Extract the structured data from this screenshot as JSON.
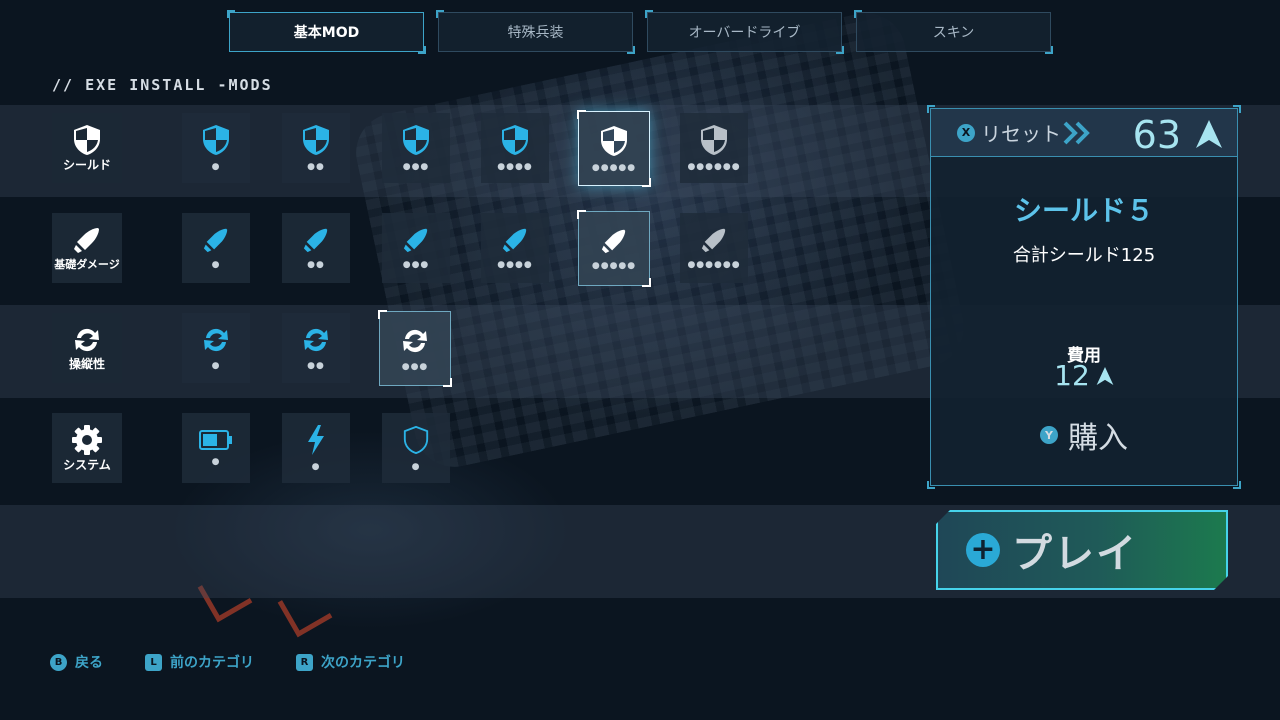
{
  "tabs": [
    {
      "label": "基本MOD",
      "active": true
    },
    {
      "label": "特殊兵装",
      "active": false
    },
    {
      "label": "オーバードライブ",
      "active": false
    },
    {
      "label": "スキン",
      "active": false
    }
  ],
  "section_title": "// EXE INSTALL -MODS",
  "categories": [
    {
      "label": "シールド",
      "icon": "shield-icon"
    },
    {
      "label": "基礎ダメージ",
      "icon": "bullet-icon"
    },
    {
      "label": "操縦性",
      "icon": "rotate-arrows-icon"
    },
    {
      "label": "システム",
      "icon": "gear-icon"
    }
  ],
  "mod_rows": {
    "shield": {
      "levels": [
        "●",
        "●●",
        "●●●",
        "●●●●",
        "●●●●●",
        "●●●●●●"
      ]
    },
    "damage": {
      "levels": [
        "●",
        "●●",
        "●●●",
        "●●●●",
        "●●●●●",
        "●●●●●●"
      ]
    },
    "handling": {
      "levels": [
        "●",
        "●●",
        "●●●"
      ]
    },
    "system": {
      "levels": [
        "●",
        "●",
        "●"
      ],
      "icons": [
        "battery-icon",
        "lightning-icon",
        "shield-outline-icon"
      ]
    }
  },
  "panel": {
    "reset_key": "X",
    "reset_label": "リセット",
    "credits": "63",
    "mod_name": "シールド５",
    "mod_desc": "合計シールド125",
    "cost_label": "費用",
    "cost_value": "12",
    "buy_key": "Y",
    "buy_label": "購入"
  },
  "play": {
    "label": "プレイ"
  },
  "hints": [
    {
      "key": "B",
      "label": "戻る"
    },
    {
      "key": "L",
      "label": "前のカテゴリ"
    },
    {
      "key": "R",
      "label": "次のカテゴリ"
    }
  ],
  "colors": {
    "accent": "#3da4c8",
    "active_icon": "#2bb3e6",
    "credit": "#a7e4f0",
    "play_green": "#1c7a4e"
  }
}
